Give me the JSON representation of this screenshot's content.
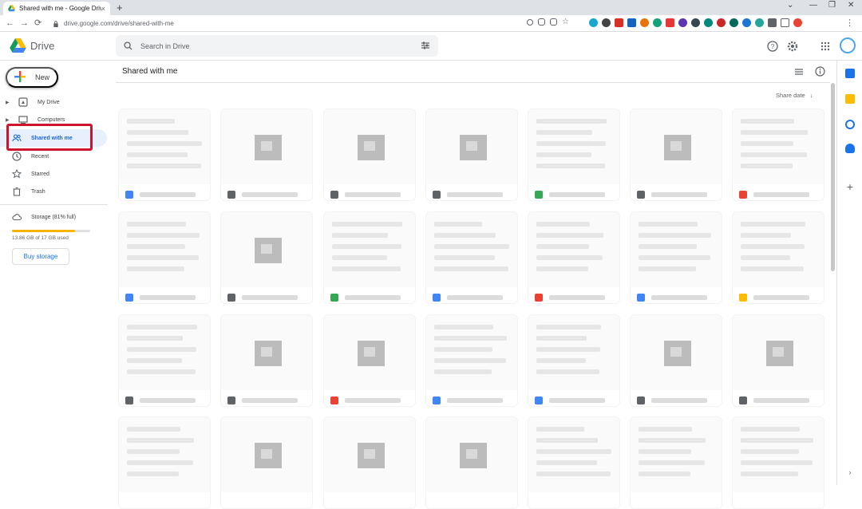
{
  "browser": {
    "tab_title": "Shared with me - Google Drive",
    "close_glyph": "×",
    "new_tab_glyph": "+",
    "url": "drive.google.com/drive/shared-with-me",
    "controls": {
      "min": "⌄",
      "minimize": "—",
      "restore": "❐",
      "close": "✕"
    }
  },
  "header": {
    "brand": "Drive",
    "search_placeholder": "Search in Drive"
  },
  "sidebar": {
    "new_label": "New",
    "items": [
      {
        "label": "My Drive",
        "icon": "my-drive-icon"
      },
      {
        "label": "Computers",
        "icon": "computer-icon"
      },
      {
        "label": "Shared with me",
        "icon": "people-icon"
      },
      {
        "label": "Recent",
        "icon": "clock-icon"
      },
      {
        "label": "Starred",
        "icon": "star-icon"
      },
      {
        "label": "Trash",
        "icon": "trash-icon"
      },
      {
        "label": "Storage (81% full)",
        "icon": "cloud-icon"
      }
    ],
    "storage_used_fraction": 0.81,
    "storage_text": "13.86 GB of 17 GB used",
    "buy_storage": "Buy storage"
  },
  "main": {
    "title": "Shared with me",
    "sort_label": "Share date",
    "sort_arrow": "↓"
  },
  "colors": {
    "accent": "#1a73e8",
    "active_bg": "#e8f0fe",
    "highlight": "#d0132c",
    "storage": "#f4b400"
  }
}
